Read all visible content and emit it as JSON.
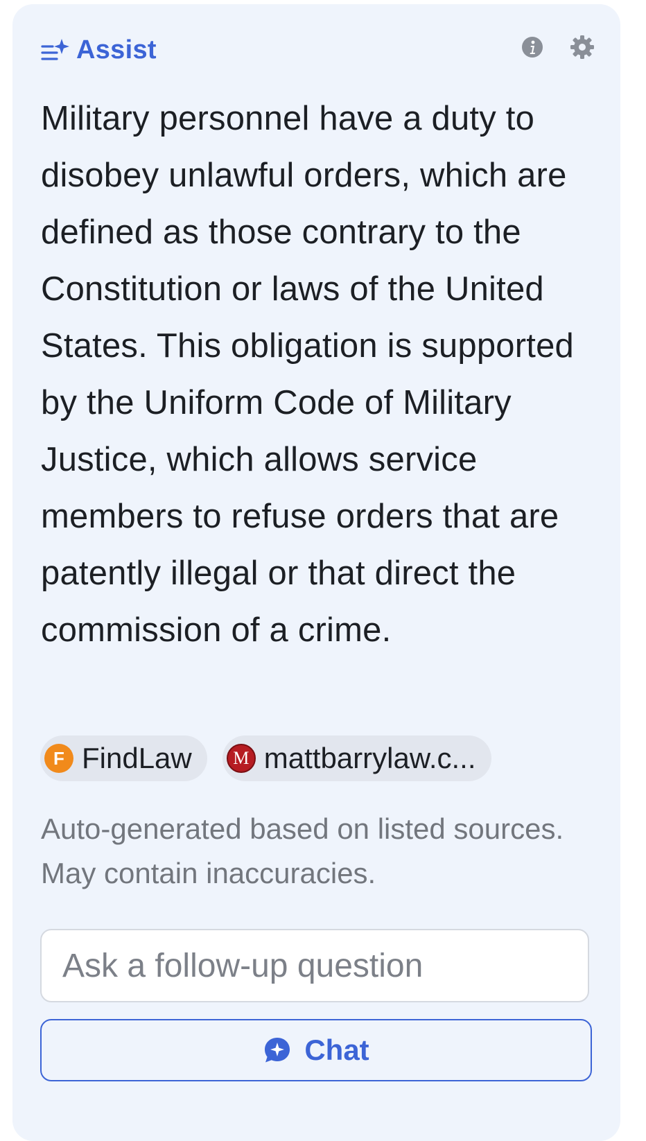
{
  "header": {
    "brand_label": "Assist",
    "brand_icon": "sparkle-list-icon",
    "info_icon": "info-icon",
    "settings_icon": "gear-icon",
    "accent_color": "#3c64d6"
  },
  "answer": {
    "text": "Military personnel have a duty to disobey unlawful orders, which are defined as those contrary to the Constitution or laws of the United States. This obligation is supported by the Uniform Code of Military Justice, which allows service members to refuse orders that are patently illegal or that direct the commission of a crime."
  },
  "sources": [
    {
      "label": "FindLaw",
      "icon_letter": "F",
      "icon_color": "#f18a1b"
    },
    {
      "label": "mattbarrylaw.c...",
      "icon_letter": "M",
      "icon_color": "#b61c22"
    }
  ],
  "disclaimer": "Auto-generated based on listed sources. May contain inaccuracies.",
  "followup": {
    "placeholder": "Ask a follow-up question",
    "value": ""
  },
  "chat_button": {
    "label": "Chat",
    "icon": "chat-bubble-sparkle-icon"
  }
}
